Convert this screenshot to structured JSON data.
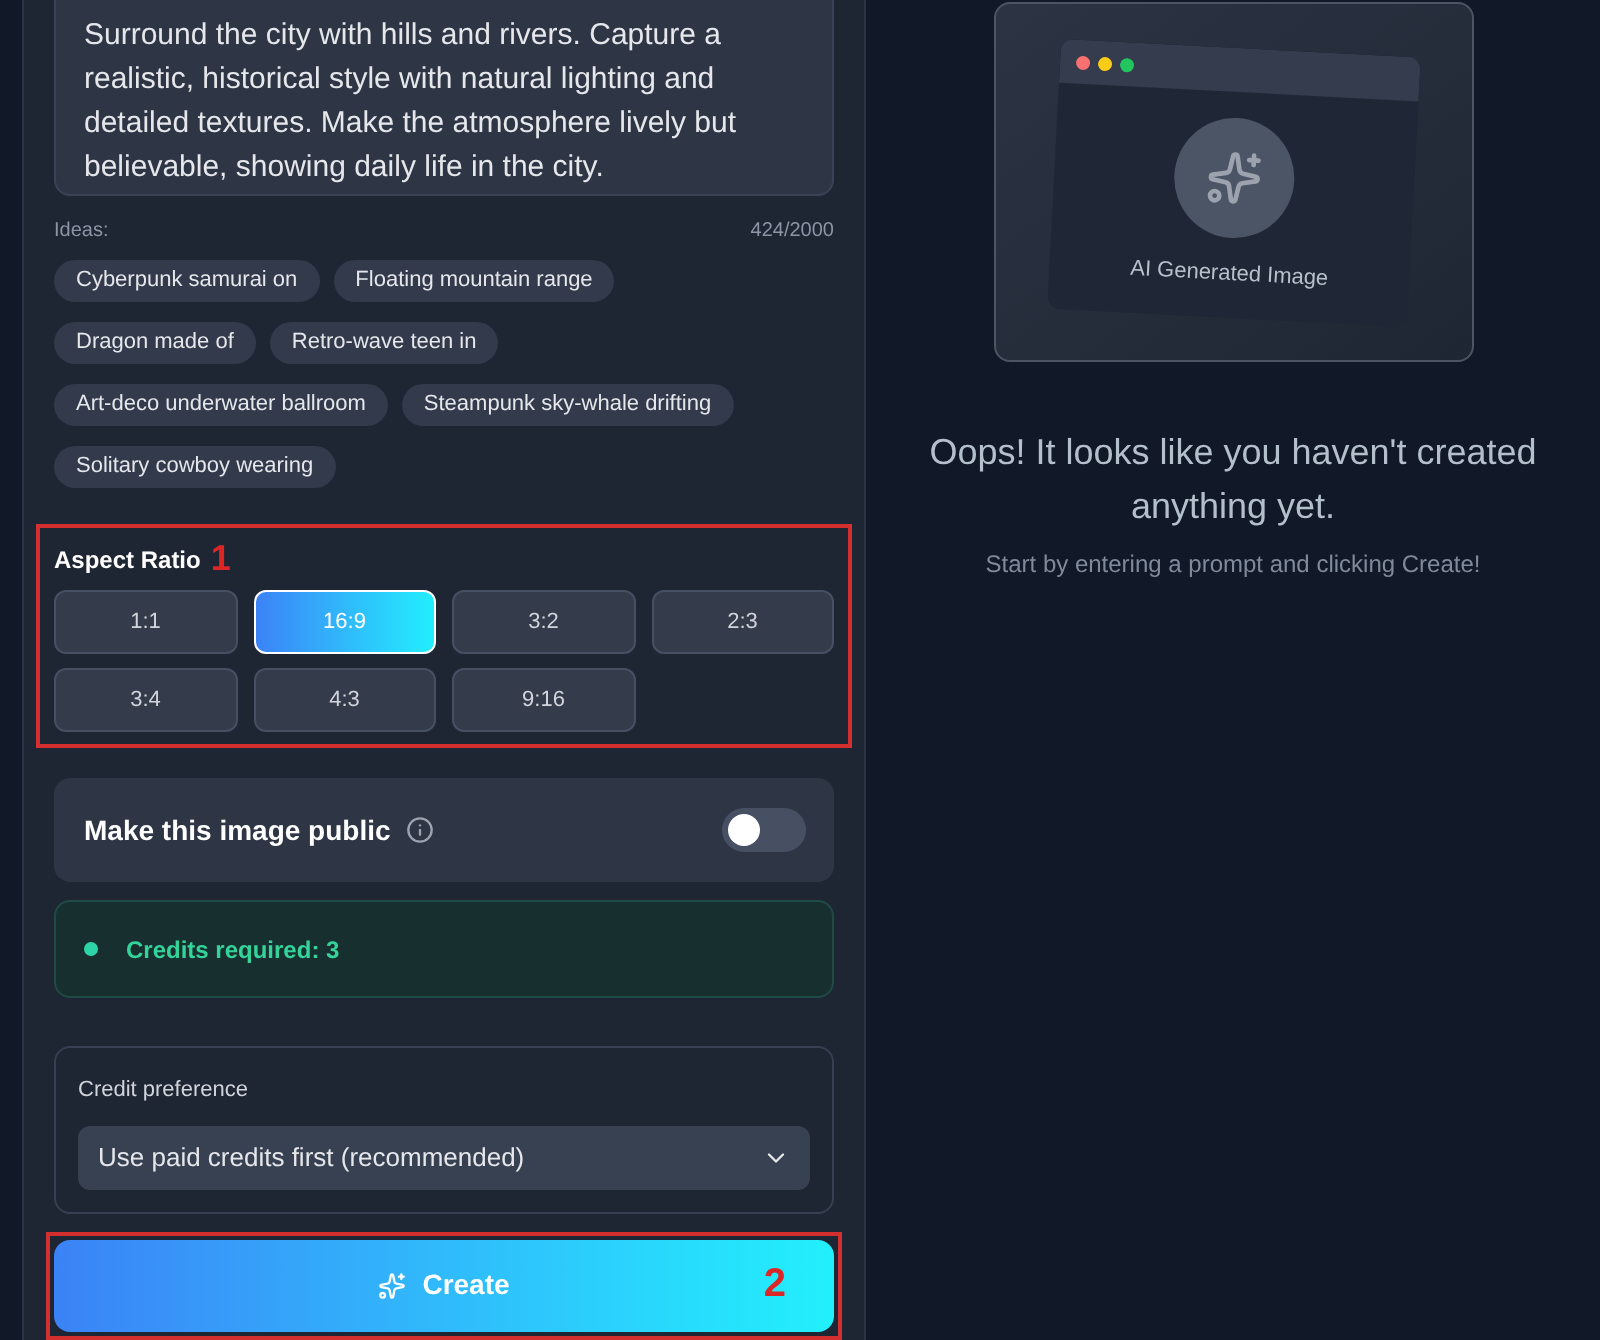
{
  "prompt": {
    "value": "Surround the city with hills and rivers. Capture a realistic, historical style with natural lighting and detailed textures. Make the atmosphere lively but believable, showing daily life in the city."
  },
  "ideas_label": "Ideas:",
  "char_count": "424/2000",
  "ideas": [
    "Cyberpunk samurai on",
    "Floating mountain range",
    "Dragon made of",
    "Retro-wave teen in",
    "Art-deco underwater ballroom",
    "Steampunk sky-whale drifting",
    "Solitary cowboy wearing"
  ],
  "aspect_ratio": {
    "title": "Aspect Ratio",
    "annotation": "1",
    "options": [
      {
        "label": "1:1",
        "selected": false
      },
      {
        "label": "16:9",
        "selected": true
      },
      {
        "label": "3:2",
        "selected": false
      },
      {
        "label": "2:3",
        "selected": false
      },
      {
        "label": "3:4",
        "selected": false
      },
      {
        "label": "4:3",
        "selected": false
      },
      {
        "label": "9:16",
        "selected": false
      }
    ]
  },
  "public_toggle": {
    "label": "Make this image public",
    "on": false
  },
  "credits": {
    "text": "Credits required: 3"
  },
  "credit_preference": {
    "label": "Credit preference",
    "value": "Use paid credits first (recommended)"
  },
  "create_button": {
    "label": "Create",
    "annotation": "2"
  },
  "preview": {
    "image_label": "AI Generated Image",
    "heading": "Oops! It looks like you haven't created anything yet.",
    "subtext": "Start by entering a prompt and clicking Create!"
  }
}
